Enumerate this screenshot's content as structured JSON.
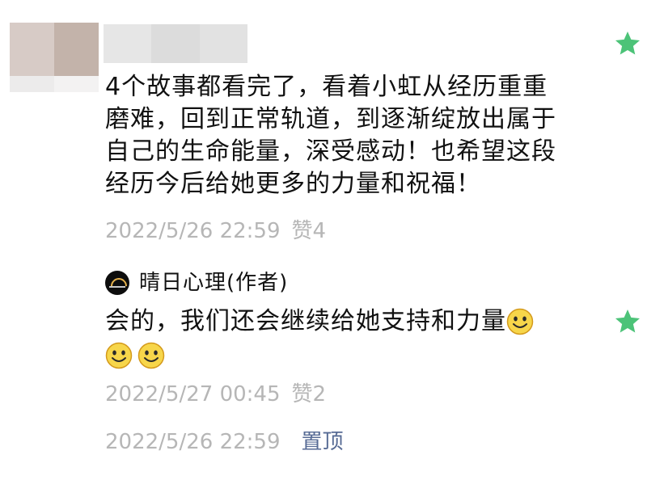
{
  "colors": {
    "star": "#4cc378",
    "meta_text": "#b6b6b6",
    "link": "#576b95",
    "text": "#111111"
  },
  "comment": {
    "text": "4个故事都看完了，看着小虹从经历重重\n磨难，回到正常轨道，到逐渐绽放出属于\n自己的生命能量，深受感动！也希望这段\n经历今后给她更多的力量和祝福！",
    "timestamp": "2022/5/26 22:59",
    "likes": "赞4",
    "starred": true,
    "star_icon": "star-icon"
  },
  "reply": {
    "author": "晴日心理(作者)",
    "text": "会的，我们还会继续给她支持和力量",
    "emoji_icon": "smile-emoji-icon",
    "timestamp": "2022/5/27 00:45",
    "likes": "赞2",
    "starred": true
  },
  "footer": {
    "timestamp": "2022/5/26 22:59",
    "pin_label": "置顶"
  }
}
